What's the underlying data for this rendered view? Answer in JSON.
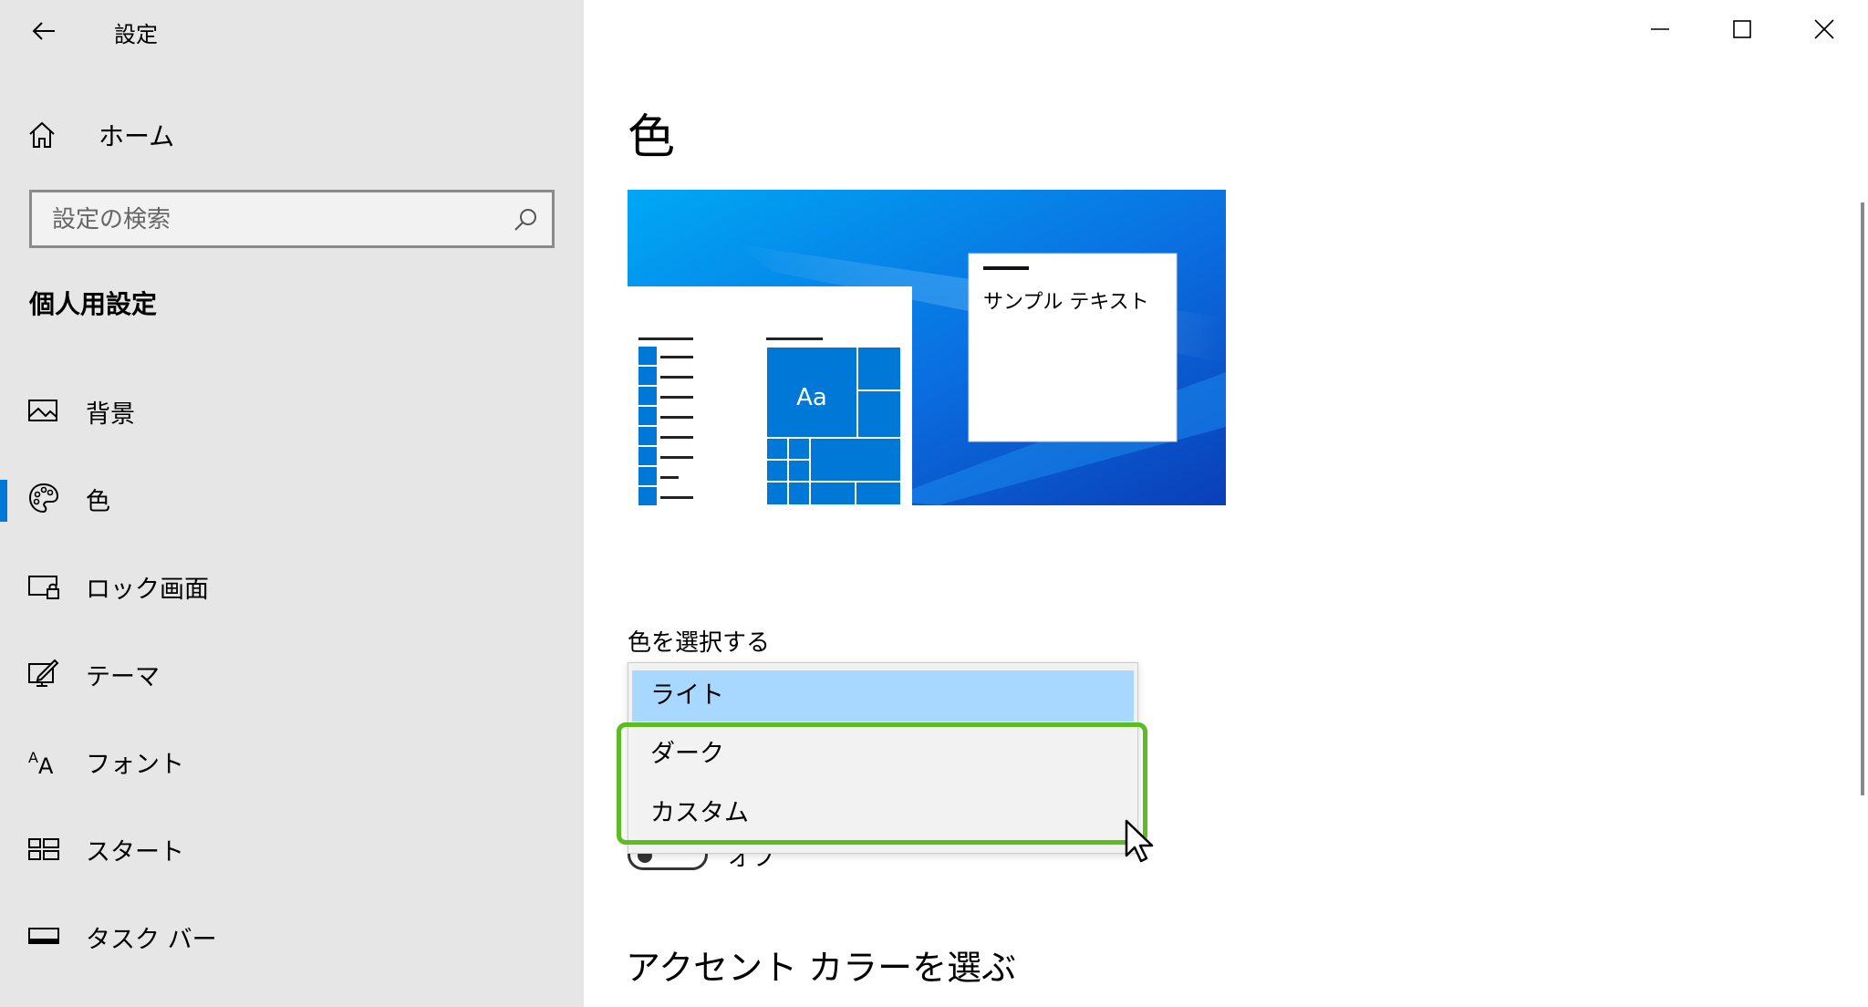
{
  "window": {
    "title": "設定",
    "controls": {
      "minimize": "minimize",
      "maximize": "maximize",
      "close": "close"
    }
  },
  "sidebar": {
    "home_label": "ホーム",
    "search": {
      "placeholder": "設定の検索",
      "value": ""
    },
    "section_title": "個人用設定",
    "items": [
      {
        "label": "背景",
        "icon": "picture-icon",
        "selected": false
      },
      {
        "label": "色",
        "icon": "palette-icon",
        "selected": true
      },
      {
        "label": "ロック画面",
        "icon": "lock-screen-icon",
        "selected": false
      },
      {
        "label": "テーマ",
        "icon": "theme-icon",
        "selected": false
      },
      {
        "label": "フォント",
        "icon": "font-icon",
        "selected": false
      },
      {
        "label": "スタート",
        "icon": "start-icon",
        "selected": false
      },
      {
        "label": "タスク バー",
        "icon": "taskbar-icon",
        "selected": false
      }
    ]
  },
  "main": {
    "page_title": "色",
    "preview": {
      "sample_text": "サンプル テキスト",
      "tile_text": "Aa"
    },
    "choose_color_label": "色を選択する",
    "dropdown": {
      "options": [
        "ライト",
        "ダーク",
        "カスタム"
      ],
      "selected_index": 0
    },
    "toggle_label": "オフ",
    "accent_title": "アクセント カラーを選ぶ"
  },
  "colors": {
    "accent": "#0078d7",
    "highlight_frame": "#5cbd20",
    "selected_option": "#a8d8ff",
    "sidebar_bg": "#e6e6e6"
  }
}
